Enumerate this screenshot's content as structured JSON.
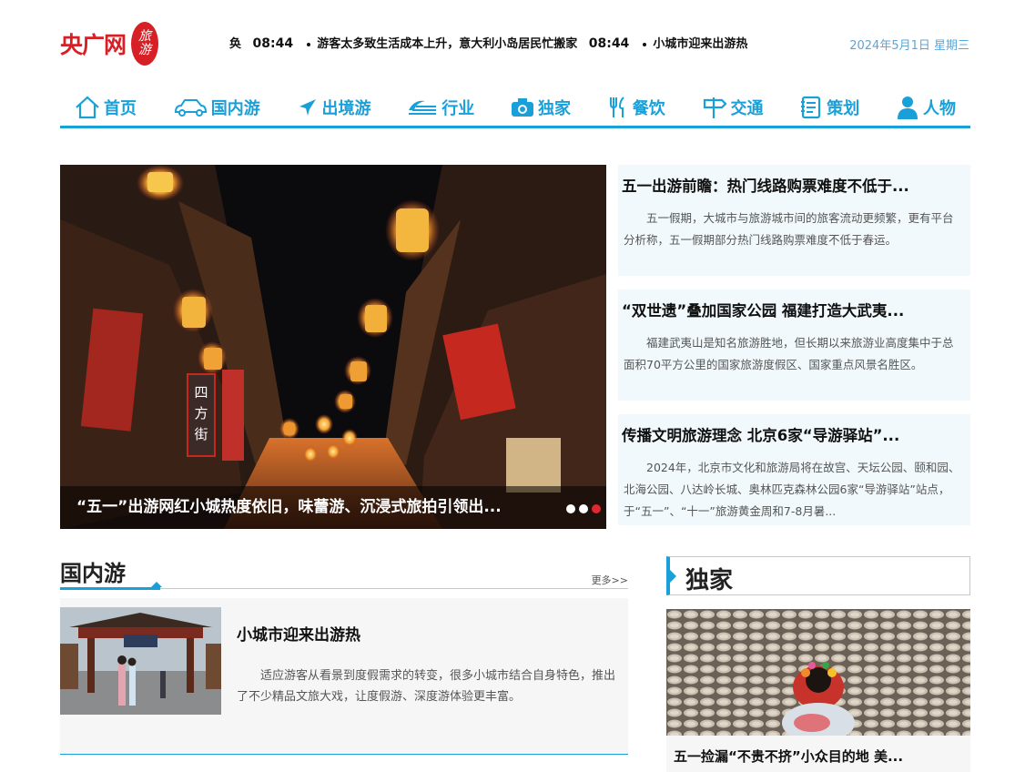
{
  "brand": {
    "logo_text": "央广网",
    "seal_char_1": "旅",
    "seal_char_2": "游"
  },
  "ticker": [
    {
      "time": "",
      "text": "奂"
    },
    {
      "time": "08:44",
      "text": "游客太多致生活成本上升，意大利小岛居民忙搬家"
    },
    {
      "time": "08:44",
      "text": "小城市迎来出游热"
    }
  ],
  "date": "2024年5月1日  星期三",
  "nav": [
    {
      "label": "首页",
      "icon": "home-icon"
    },
    {
      "label": "国内游",
      "icon": "car-icon"
    },
    {
      "label": "出境游",
      "icon": "plane-icon"
    },
    {
      "label": "行业",
      "icon": "wave-icon"
    },
    {
      "label": "独家",
      "icon": "camera-icon"
    },
    {
      "label": "餐饮",
      "icon": "utensils-icon"
    },
    {
      "label": "交通",
      "icon": "signpost-icon"
    },
    {
      "label": "策划",
      "icon": "notebook-icon"
    },
    {
      "label": "人物",
      "icon": "person-icon"
    }
  ],
  "hero": {
    "caption": "“五一”出游网红小城热度依旧，味蕾游、沉浸式旅拍引领出...",
    "slides": 3,
    "active_slide": 3,
    "sign_text": "四方街"
  },
  "news": [
    {
      "title": "五一出游前瞻：热门线路购票难度不低于...",
      "body": "五一假期，大城市与旅游城市间的旅客流动更频繁，更有平台分析称，五一假期部分热门线路购票难度不低于春运。"
    },
    {
      "title": "“双世遗”叠加国家公园 福建打造大武夷...",
      "body": "福建武夷山是知名旅游胜地，但长期以来旅游业高度集中于总面积70平方公里的国家旅游度假区、国家重点风景名胜区。"
    },
    {
      "title": "传播文明旅游理念 北京6家“导游驿站”...",
      "body": "2024年，北京市文化和旅游局将在故宫、天坛公园、颐和园、北海公园、八达岭长城、奥林匹克森林公园6家“导游驿站”站点，于“五一”、“十一”旅游黄金周和7-8月暑..."
    }
  ],
  "domestic": {
    "title": "国内游",
    "more": "更多>>",
    "article": {
      "title": "小城市迎来出游热",
      "body": "适应游客从看景到度假需求的转变，很多小城市结合自身特色，推出了不少精品文旅大戏，让度假游、深度游体验更丰富。"
    }
  },
  "exclusive": {
    "title": "独家",
    "caption": "五一捡漏“不贵不挤”小众目的地 美..."
  },
  "colors": {
    "accent": "#1aa0d8",
    "brand_red": "#d71f26",
    "card_bg": "#f1f9fd"
  }
}
